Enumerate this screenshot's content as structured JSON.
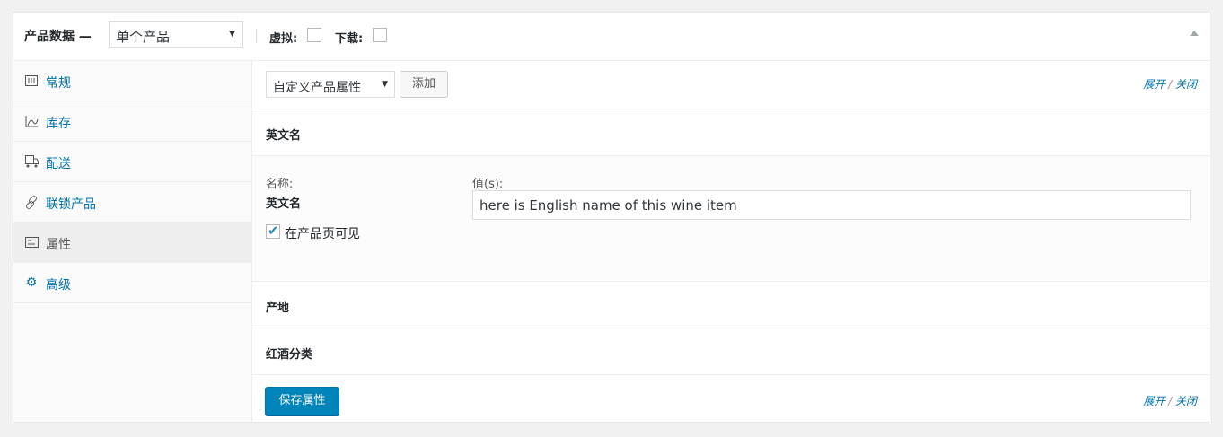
{
  "header": {
    "title": "产品数据 —",
    "product_type": "单个产品",
    "virtual_label": "虚拟:",
    "download_label": "下载:"
  },
  "sidebar": {
    "items": [
      {
        "label": "常规",
        "icon": "general-icon"
      },
      {
        "label": "库存",
        "icon": "inventory-icon"
      },
      {
        "label": "配送",
        "icon": "shipping-icon"
      },
      {
        "label": "联锁产品",
        "icon": "linked-products-icon"
      },
      {
        "label": "属性",
        "icon": "attributes-icon",
        "active": true
      },
      {
        "label": "高级",
        "icon": "advanced-gear-icon"
      }
    ]
  },
  "toolbar": {
    "attribute_select": "自定义产品属性",
    "add_label": "添加",
    "expand_label": "展开",
    "separator": "/",
    "close_label": "关闭"
  },
  "attributes": [
    {
      "title": "英文名",
      "expanded": true,
      "name_label": "名称:",
      "name_value": "英文名",
      "values_label": "值(s):",
      "value": "here is English name of this wine item",
      "visible_label": "在产品页可见",
      "visible_checked": true
    },
    {
      "title": "产地"
    },
    {
      "title": "红酒分类"
    }
  ],
  "footer": {
    "save_label": "保存属性",
    "expand_label": "展开",
    "separator": "/",
    "close_label": "关闭"
  },
  "colors": {
    "link": "#0073aa",
    "primary_button": "#0085ba"
  }
}
